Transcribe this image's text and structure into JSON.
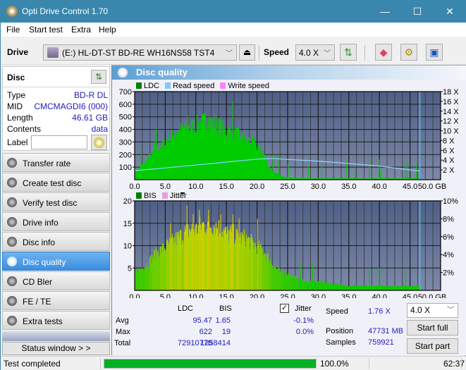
{
  "window": {
    "title": "Opti Drive Control 1.70",
    "controls": {
      "minimize": "—",
      "maximize": "☐",
      "close": "✕"
    }
  },
  "menu": [
    "File",
    "Start test",
    "Extra",
    "Help"
  ],
  "toolbar": {
    "drive_label": "Drive",
    "drive_value": "(E:)  HL-DT-ST BD-RE  WH16NS58 TST4",
    "eject_icon": "⏏",
    "speed_label": "Speed",
    "speed_value": "4.0 X",
    "icons": [
      "refresh-icon",
      "eraser-icon",
      "settings-icon",
      "save-icon"
    ]
  },
  "disc": {
    "heading": "Disc",
    "rows": [
      {
        "key": "Type",
        "value": "BD-R DL"
      },
      {
        "key": "MID",
        "value": "CMCMAGDI6 (000)"
      },
      {
        "key": "Length",
        "value": "46.61 GB"
      },
      {
        "key": "Contents",
        "value": "data"
      }
    ],
    "label_key": "Label",
    "label_value": ""
  },
  "nav": [
    {
      "label": "Transfer rate",
      "active": false
    },
    {
      "label": "Create test disc",
      "active": false
    },
    {
      "label": "Verify test disc",
      "active": false
    },
    {
      "label": "Drive info",
      "active": false
    },
    {
      "label": "Disc info",
      "active": false
    },
    {
      "label": "Disc quality",
      "active": true
    },
    {
      "label": "CD Bler",
      "active": false
    },
    {
      "label": "FE / TE",
      "active": false
    },
    {
      "label": "Extra tests",
      "active": false
    }
  ],
  "status_window_button": "Status window > >",
  "panel": {
    "title": "Disc quality"
  },
  "chart_data": [
    {
      "type": "bar",
      "title": "LDC",
      "legend": [
        {
          "name": "LDC",
          "color": "#008000"
        },
        {
          "name": "Read speed",
          "color": "#80c8ff"
        },
        {
          "name": "Write speed",
          "color": "#ff80ff"
        }
      ],
      "xlabel": "GB",
      "x_ticks": [
        "0.0",
        "5.0",
        "10.0",
        "15.0",
        "20.0",
        "25.0",
        "30.0",
        "35.0",
        "40.0",
        "45.0",
        "50.0 GB"
      ],
      "xlim": [
        0,
        50
      ],
      "y_ticks": [
        "100",
        "200",
        "300",
        "400",
        "500",
        "600",
        "700"
      ],
      "ylim": [
        0,
        700
      ],
      "y2_ticks": [
        "2 X",
        "4 X",
        "6 X",
        "8 X",
        "10 X",
        "12 X",
        "14 X",
        "16 X",
        "18 X"
      ],
      "y2lim": [
        0,
        18
      ],
      "grid": true,
      "end_marker_x": 46.61,
      "ldc_envelope": {
        "x": [
          0,
          1,
          2,
          3,
          4,
          5,
          6,
          7,
          8,
          9,
          10,
          11,
          12,
          13,
          14,
          15,
          16,
          17,
          18,
          19,
          20,
          21,
          21.5,
          22,
          23,
          24,
          25,
          26,
          28,
          30,
          32,
          35,
          38,
          40,
          42,
          44,
          45,
          46,
          46.61
        ],
        "y": [
          70,
          110,
          170,
          220,
          270,
          310,
          350,
          390,
          420,
          430,
          450,
          470,
          480,
          460,
          420,
          400,
          380,
          360,
          330,
          310,
          270,
          220,
          160,
          100,
          50,
          30,
          20,
          15,
          12,
          10,
          10,
          10,
          10,
          10,
          10,
          10,
          12,
          10,
          10
        ]
      },
      "ldc_spikes": [
        {
          "x": 1.0,
          "y": 250
        },
        {
          "x": 3.2,
          "y": 300
        },
        {
          "x": 3.5,
          "y": 400
        },
        {
          "x": 6.0,
          "y": 380
        },
        {
          "x": 8.6,
          "y": 510
        },
        {
          "x": 11.0,
          "y": 520
        },
        {
          "x": 12.0,
          "y": 500
        },
        {
          "x": 14.1,
          "y": 500
        },
        {
          "x": 16.0,
          "y": 622
        },
        {
          "x": 22.5,
          "y": 200
        },
        {
          "x": 23.5,
          "y": 200
        },
        {
          "x": 25.0,
          "y": 130
        },
        {
          "x": 28.3,
          "y": 110
        },
        {
          "x": 30.5,
          "y": 120
        },
        {
          "x": 34.5,
          "y": 145
        },
        {
          "x": 36.0,
          "y": 100
        },
        {
          "x": 38.3,
          "y": 150
        },
        {
          "x": 39.9,
          "y": 160
        },
        {
          "x": 40.1,
          "y": 80
        },
        {
          "x": 44.2,
          "y": 140
        },
        {
          "x": 44.5,
          "y": 150
        },
        {
          "x": 46.0,
          "y": 120
        }
      ],
      "read_speed": {
        "x": [
          0,
          5,
          10,
          15,
          20,
          22.5,
          25,
          30,
          35,
          40,
          45,
          46.61
        ],
        "y": [
          1.85,
          2.4,
          3.0,
          3.6,
          4.2,
          4.35,
          4.15,
          3.8,
          3.3,
          2.8,
          2.0,
          1.76
        ]
      }
    },
    {
      "type": "bar",
      "title": "BIS",
      "legend": [
        {
          "name": "BIS",
          "color": "#008000"
        },
        {
          "name": "Jitter",
          "color": "#e0a0e0"
        }
      ],
      "xlabel": "GB",
      "x_ticks": [
        "0.0",
        "5.0",
        "10.0",
        "15.0",
        "20.0",
        "25.0",
        "30.0",
        "35.0",
        "40.0",
        "45.0",
        "50.0 GB"
      ],
      "xlim": [
        0,
        50
      ],
      "y_ticks": [
        "5",
        "10",
        "15",
        "20"
      ],
      "ylim": [
        0,
        20
      ],
      "y2_ticks": [
        "2%",
        "4%",
        "6%",
        "8%",
        "10%"
      ],
      "y2lim": [
        0,
        10
      ],
      "grid": true,
      "end_marker_x": 46.61,
      "bis_envelope": {
        "x": [
          0,
          1,
          2,
          3,
          4,
          5,
          6,
          7,
          8,
          9,
          10,
          11,
          12,
          13,
          14,
          15,
          16,
          17,
          18,
          19,
          20,
          21,
          22,
          23,
          24,
          25,
          26,
          28,
          30,
          35,
          40,
          45,
          46.61
        ],
        "y": [
          4,
          5,
          6,
          8,
          9,
          10,
          11,
          12,
          13,
          14,
          14,
          15,
          15,
          15,
          14,
          13,
          13,
          12,
          12,
          11,
          10,
          9,
          7,
          5,
          4,
          4,
          3,
          2,
          2,
          1,
          1,
          1,
          1
        ]
      },
      "bis_spikes": [
        {
          "x": 5.8,
          "y": 15
        },
        {
          "x": 8.5,
          "y": 19
        },
        {
          "x": 9.5,
          "y": 17
        },
        {
          "x": 10.5,
          "y": 18
        },
        {
          "x": 12.0,
          "y": 18
        },
        {
          "x": 14.0,
          "y": 17
        },
        {
          "x": 16.0,
          "y": 17
        },
        {
          "x": 17.0,
          "y": 16
        },
        {
          "x": 20.0,
          "y": 16
        },
        {
          "x": 27.0,
          "y": 6
        },
        {
          "x": 29.0,
          "y": 6
        },
        {
          "x": 38.3,
          "y": 5
        },
        {
          "x": 39.9,
          "y": 5
        },
        {
          "x": 44.2,
          "y": 5
        }
      ]
    }
  ],
  "stats": {
    "col_ldc": "LDC",
    "col_bis": "BIS",
    "jitter_label": "Jitter",
    "jitter_checked": true,
    "rows": [
      {
        "label": "Avg",
        "ldc": "95.47",
        "bis": "1.65",
        "jitter": "-0.1%"
      },
      {
        "label": "Max",
        "ldc": "622",
        "bis": "19",
        "jitter": "0.0%"
      },
      {
        "label": "Total",
        "ldc": "72910778",
        "bis": "1258414",
        "jitter": ""
      }
    ],
    "speed_label": "Speed",
    "speed_value": "1.76 X",
    "position_label": "Position",
    "position_value": "47731 MB",
    "samples_label": "Samples",
    "samples_value": "759921",
    "speed_select": "4.0 X",
    "start_full": "Start full",
    "start_part": "Start part"
  },
  "statusbar": {
    "text": "Test completed",
    "progress": 100,
    "progress_text": "100.0%",
    "time": "62:37"
  }
}
